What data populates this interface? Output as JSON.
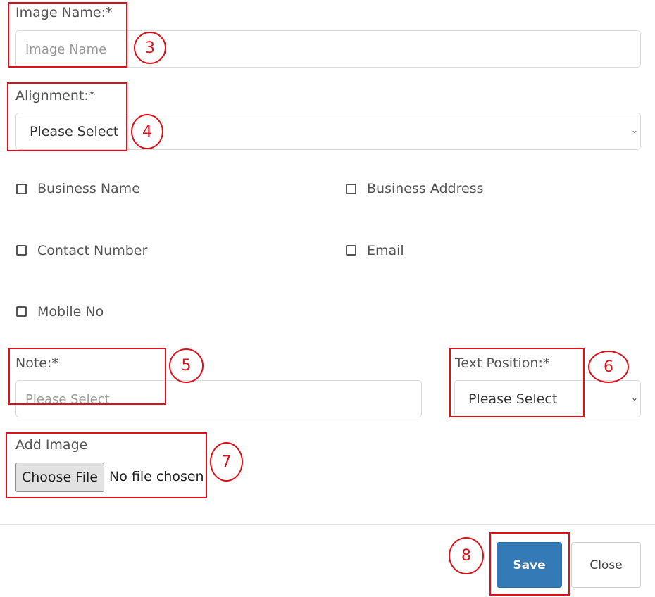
{
  "image_name": {
    "label": "Image Name:*",
    "placeholder": "Image Name"
  },
  "alignment": {
    "label": "Alignment:*",
    "selected": "Please Select"
  },
  "checkboxes": [
    {
      "label": "Business Name"
    },
    {
      "label": "Business Address"
    },
    {
      "label": "Contact Number"
    },
    {
      "label": "Email"
    },
    {
      "label": "Mobile No"
    }
  ],
  "note": {
    "label": "Note:*",
    "placeholder": "Please Select"
  },
  "text_position": {
    "label": "Text Position:*",
    "selected": "Please Select"
  },
  "add_image": {
    "label": "Add Image",
    "button": "Choose File",
    "status": "No file chosen"
  },
  "footer": {
    "save": "Save",
    "close": "Close"
  },
  "annotations": [
    "3",
    "4",
    "5",
    "6",
    "7",
    "8"
  ],
  "colors": {
    "annotation": "#e0101b",
    "primary": "#337ab7"
  },
  "icons": {
    "select_arrow": "chevron-down-icon"
  }
}
